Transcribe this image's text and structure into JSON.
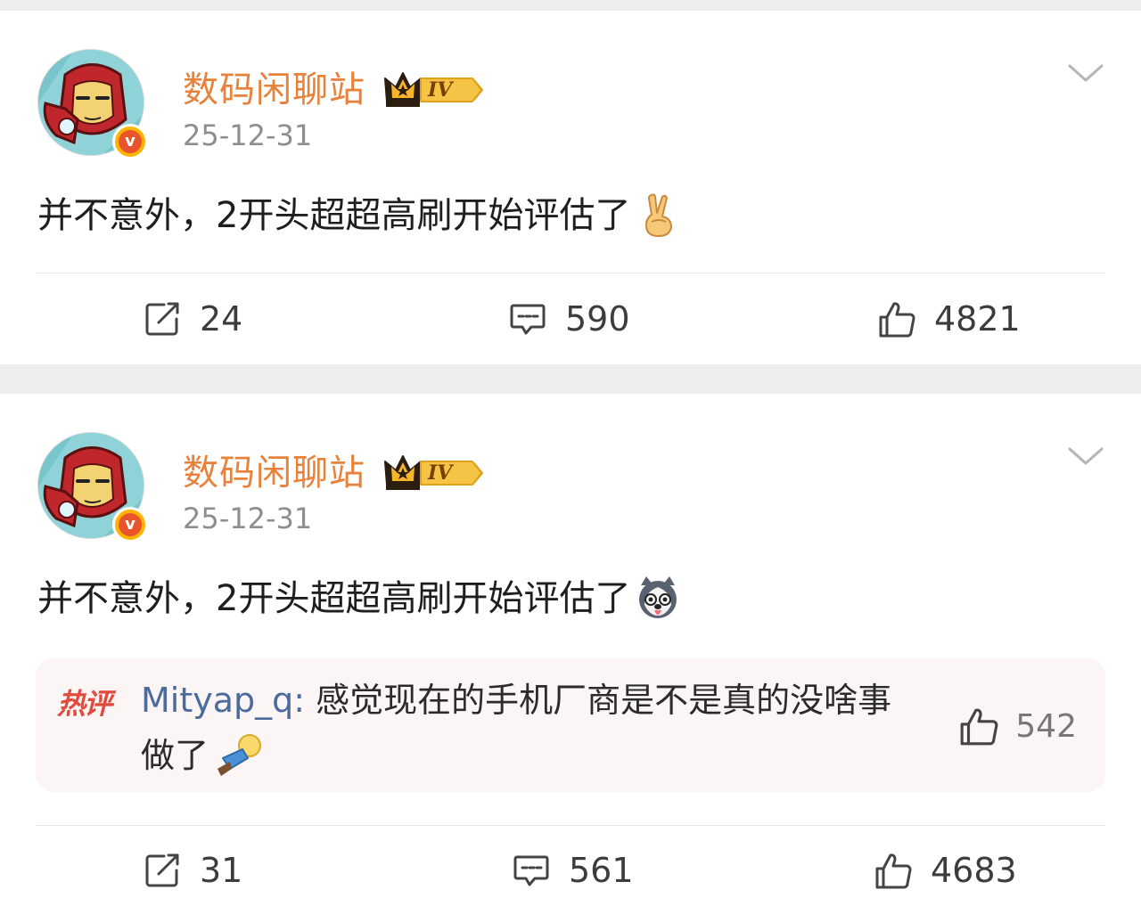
{
  "posts": [
    {
      "author": "数码闲聊站",
      "level": "IV",
      "date": "25-12-31",
      "text": "并不意外，2开头超超高刷开始评估了",
      "emoji_icon": "victory-hand-emoji",
      "actions": {
        "repost": "24",
        "comments": "590",
        "likes": "4821"
      }
    },
    {
      "author": "数码闲聊站",
      "level": "IV",
      "date": "25-12-31",
      "text": "并不意外，2开头超超高刷开始评估了",
      "emoji_icon": "husky-dog-emoji",
      "hot_comment": {
        "tag": "热评",
        "user": "Mityap_q",
        "separator": ":",
        "text": " 感觉现在的手机厂商是不是真的没啥事做了",
        "emoji_icon": "lying-flat-emoji",
        "likes": "542"
      },
      "actions": {
        "repost": "31",
        "comments": "561",
        "likes": "4683"
      }
    }
  ],
  "colors": {
    "author": "#e8813a",
    "date": "#8e8e8e",
    "hot_tag": "#e24a3c",
    "hot_user": "#4c6a9c",
    "feed_bg": "#ededed"
  }
}
